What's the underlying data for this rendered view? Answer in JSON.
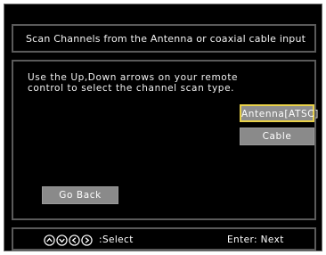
{
  "title": "Scan Channels from the Antenna or coaxial cable input",
  "instruction": {
    "line1": "Use the Up,Down arrows on your remote",
    "line2": "control to select the channel scan type."
  },
  "options": [
    {
      "label": "Antenna[ATSC]",
      "selected": true
    },
    {
      "label": "Cable",
      "selected": false
    }
  ],
  "go_back_label": "Go Back",
  "footer": {
    "select_hint": ":Select",
    "next_hint": "Enter: Next",
    "nav_icons": [
      "up-arrow-icon",
      "down-arrow-icon",
      "left-arrow-icon",
      "right-arrow-icon"
    ]
  },
  "colors": {
    "background": "#000000",
    "panel_border": "#5a5a5a",
    "button_fill": "#8a8a8a",
    "selected_border": "#e8d14a",
    "text": "#ffffff"
  }
}
